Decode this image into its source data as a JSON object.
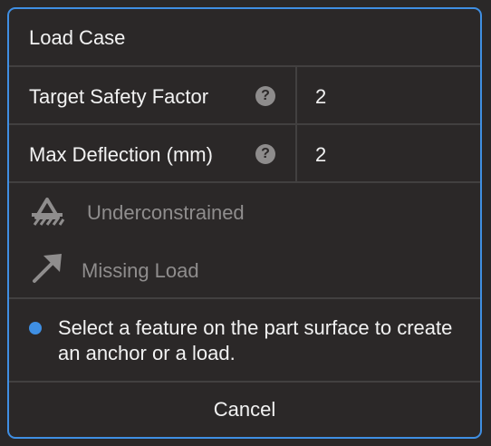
{
  "dialog": {
    "title": "Load Case"
  },
  "fields": [
    {
      "label": "Target Safety Factor",
      "help_icon": "question-circle-icon",
      "value": "2"
    },
    {
      "label": "Max Deflection (mm)",
      "help_icon": "question-circle-icon",
      "value": "2"
    }
  ],
  "status": [
    {
      "icon": "anchor-constraint-icon",
      "label": "Underconstrained"
    },
    {
      "icon": "load-arrow-icon",
      "label": "Missing Load"
    }
  ],
  "info": {
    "icon": "info-dot-icon",
    "text": "Select a feature on the part surface to create an anchor or a load."
  },
  "actions": {
    "cancel_label": "Cancel"
  },
  "colors": {
    "accent": "#3f8fe3",
    "background": "#2b2828",
    "divider": "#424040",
    "text": "#f2f2f2",
    "muted_text": "#8f8d8d"
  }
}
